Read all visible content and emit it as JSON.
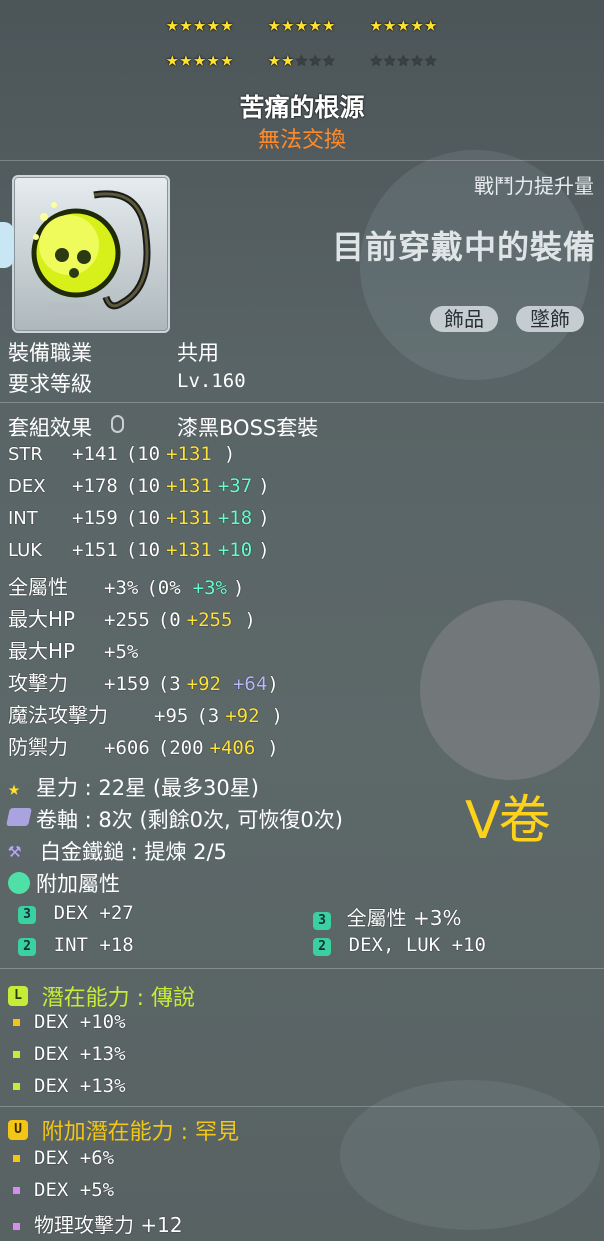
{
  "stars": {
    "row1": [
      "★★★★★",
      "★★★★★",
      "★★★★★"
    ],
    "row2_on_a": "★★★★★",
    "row2_on_b": "★★",
    "row2_off_b": "★★★",
    "row2_off_c": "★★★★★",
    "count": 22,
    "max": 30
  },
  "item": {
    "name": "苦痛的根源",
    "trade": "無法交換",
    "power_label": "戰鬥力提升量",
    "equipped_label": "目前穿戴中的裝備",
    "tags": [
      "飾品",
      "墜飾"
    ]
  },
  "req": {
    "job_label": "裝備職業",
    "job_value": "共用",
    "level_label": "要求等級",
    "level_value": "Lv.160"
  },
  "set": {
    "label": "套組效果",
    "value": "漆黑BOSS套裝"
  },
  "stats": [
    {
      "name": "STR",
      "total": "+141",
      "open": "(10",
      "a": "+131",
      "b": "",
      "close": ")"
    },
    {
      "name": "DEX",
      "total": "+178",
      "open": "(10",
      "a": "+131",
      "b": "+37",
      "close": ")"
    },
    {
      "name": "INT",
      "total": "+159",
      "open": "(10",
      "a": "+131",
      "b": "+18",
      "close": ")"
    },
    {
      "name": "LUK",
      "total": "+151",
      "open": "(10",
      "a": "+131",
      "b": "+10",
      "close": ")"
    },
    {
      "name": "全屬性",
      "total": "+3%",
      "open": "(0%",
      "a": "",
      "b": "+3%",
      "close": ")"
    },
    {
      "name": "最大HP",
      "total": "+255",
      "open": "(0",
      "a": "+255",
      "b": "",
      "close": ")"
    },
    {
      "name": "最大HP",
      "total": "+5%",
      "open": "",
      "a": "",
      "b": "",
      "close": ""
    },
    {
      "name": "攻擊力",
      "total": "+159",
      "open": "(3",
      "a": "+92",
      "c": "+64",
      "close": ")"
    },
    {
      "name": "魔法攻擊力",
      "total": "+95",
      "open": "(3",
      "a": "+92",
      "b": "",
      "close": ")"
    },
    {
      "name": "防禦力",
      "total": "+606",
      "open": "(200",
      "a": "+406",
      "b": "",
      "close": ")"
    }
  ],
  "info": {
    "star_text": "星力 : 22星 (最多30星)",
    "scroll_text": "卷軸 : 8次 (剩餘0次, 可恢復0次)",
    "hammer_text": "白金鐵鎚 : 提煉 2/5",
    "bonus_label": "附加屬性",
    "v_note": "V卷"
  },
  "bonus": [
    {
      "tier": "3",
      "text": "DEX  +27"
    },
    {
      "tier": "3",
      "text": "全屬性 +3%"
    },
    {
      "tier": "2",
      "text": "INT  +18"
    },
    {
      "tier": "2",
      "text": "DEX, LUK  +10"
    }
  ],
  "potential": {
    "badge": "L",
    "label": "潛在能力 : 傳說",
    "lines": [
      "DEX +10%",
      "DEX +13%",
      "DEX +13%"
    ]
  },
  "additional": {
    "badge": "U",
    "label": "附加潛在能力 : 罕見",
    "lines": [
      "DEX +6%",
      "DEX +5%",
      "物理攻擊力 +12"
    ]
  },
  "colors": {
    "legendary": "#c6ec3a",
    "unique": "#f3c514",
    "rare_bullet": "#d88cf0",
    "star_on": "#ffe230"
  }
}
